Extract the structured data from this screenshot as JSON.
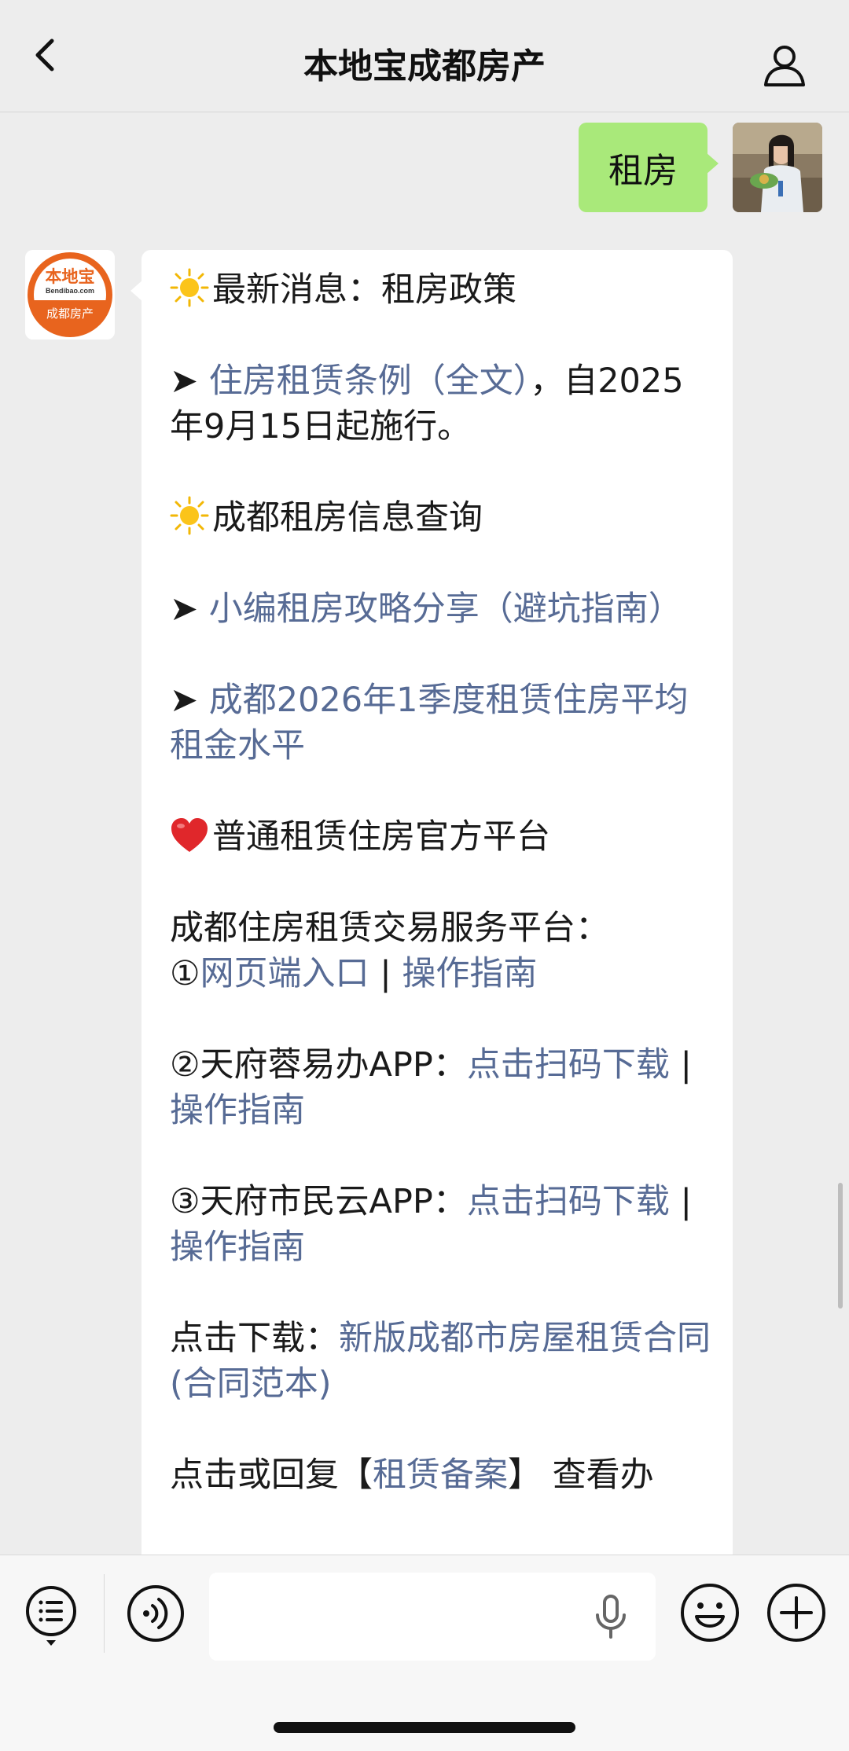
{
  "header": {
    "title": "本地宝成都房产"
  },
  "conversation": {
    "user_message": "租房",
    "bot_avatar_text": {
      "brand": "本地宝",
      "domain": "Bendibao.com",
      "sub": "成都房产"
    },
    "bot_message": {
      "section1_title": "最新消息：租房政策",
      "item1_arrow": "➤ ",
      "item1_link": "住房租赁条例（全文）",
      "item1_rest": "，自2025年9月15日起施行。",
      "section2_title": "成都租房信息查询",
      "item2_arrow": "➤ ",
      "item2_link": "小编租房攻略分享（避坑指南）",
      "item3_arrow": "➤ ",
      "item3_link": "成都2026年1季度租赁住房平均租金水平",
      "section3_title": "普通租赁住房官方平台",
      "platform_label": "成都住房租赁交易服务平台：",
      "p1_prefix": "①",
      "p1_link1": "网页端入口",
      "p1_sep": " | ",
      "p1_link2": "操作指南",
      "p2_prefix": "②天府蓉易办APP：",
      "p2_link1": "点击扫码下载",
      "p2_sep": " | ",
      "p2_link2": "操作指南",
      "p3_prefix": "③天府市民云APP：",
      "p3_link1": "点击扫码下载",
      "p3_sep": " | ",
      "p3_link2": "操作指南",
      "download_prefix": "点击下载：",
      "download_link": "新版成都市房屋租赁合同(合同范本)",
      "reply_prefix": "点击或回复【",
      "reply_link": "租赁备案",
      "reply_rest": "】 查看办"
    }
  },
  "icons": {
    "back": "chevron-left-icon",
    "profile": "person-icon",
    "sun": "sun-icon",
    "heart": "heart-icon",
    "menu": "menu-list-icon",
    "voice": "voice-icon",
    "mic": "microphone-icon",
    "emoji": "emoji-icon",
    "plus": "plus-icon"
  },
  "colors": {
    "background": "#ededed",
    "user_bubble": "#a9e97a",
    "bot_bubble": "#ffffff",
    "link": "#576b95",
    "brand_orange": "#e8641e"
  }
}
